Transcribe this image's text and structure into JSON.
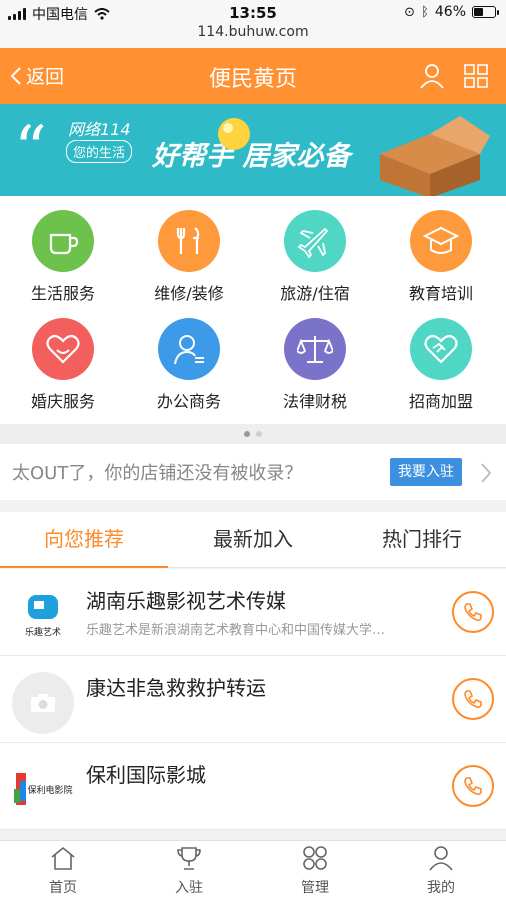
{
  "status_bar": {
    "carrier": "中国电信",
    "time": "13:55",
    "battery": "46%",
    "battery_level": 0.46,
    "url": "114.buhuw.com"
  },
  "header": {
    "back_label": "返回",
    "title": "便民黄页",
    "user_icon": "user-icon",
    "menu_icon": "grid-icon",
    "color": "#ff9133"
  },
  "banner": {
    "brand": "网络114",
    "tag": "您的生活",
    "slogan": "好帮手 居家必备",
    "color": "#2ebac6"
  },
  "categories": [
    {
      "label": "生活服务",
      "icon": "coffee-cup-icon",
      "color": "#6cc24a"
    },
    {
      "label": "维修/装修",
      "icon": "tools-icon",
      "color": "#ff9a3c"
    },
    {
      "label": "旅游/住宿",
      "icon": "airplane-icon",
      "color": "#4fd6c5"
    },
    {
      "label": "教育培训",
      "icon": "graduation-cap-icon",
      "color": "#ff9a3c"
    },
    {
      "label": "婚庆服务",
      "icon": "heart-icon",
      "color": "#f25f5c"
    },
    {
      "label": "办公商务",
      "icon": "person-icon",
      "color": "#3d9ae8"
    },
    {
      "label": "法律财税",
      "icon": "scales-icon",
      "color": "#7b73c9"
    },
    {
      "label": "招商加盟",
      "icon": "handshake-icon",
      "color": "#4fd6c5"
    }
  ],
  "join": {
    "message": "太OUT了，你的店铺还没有被收录？",
    "button": "我要入驻"
  },
  "tabs": [
    {
      "label": "向您推荐"
    },
    {
      "label": "最新加入"
    },
    {
      "label": "热门排行"
    }
  ],
  "listings": [
    {
      "name": "湖南乐趣影视艺术传媒",
      "description": "乐趣艺术是新浪湖南艺术教育中心和中国传媒大学…",
      "logo_text": "乐趣艺术"
    },
    {
      "name": "康达非急救救护转运",
      "description": "",
      "logo_text": ""
    },
    {
      "name": "保利国际影城",
      "description": "",
      "logo_text": "保利电影院"
    }
  ],
  "bottom_nav": [
    {
      "label": "首页",
      "icon": "home-icon"
    },
    {
      "label": "入驻",
      "icon": "trophy-icon"
    },
    {
      "label": "管理",
      "icon": "grid-icon"
    },
    {
      "label": "我的",
      "icon": "user-icon"
    }
  ],
  "accent_color": "#ff8a2a"
}
